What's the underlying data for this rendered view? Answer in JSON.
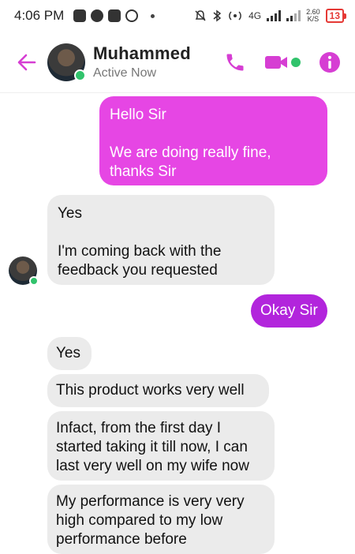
{
  "status_bar": {
    "time": "4:06 PM",
    "network": "4G",
    "speed_value": "2.60",
    "speed_unit": "K/S",
    "battery": "13"
  },
  "header": {
    "contact_name": "Muhammed",
    "contact_status": "Active Now",
    "icons": [
      "back-arrow-icon",
      "phone-icon",
      "video-camera-icon",
      "info-icon"
    ],
    "accent_color": "#d63ed3"
  },
  "messages": [
    {
      "direction": "outgoing",
      "text": "Hello Sir\n\nWe are doing really fine, thanks Sir",
      "color": "#e646e4"
    },
    {
      "direction": "incoming",
      "text": "Yes\n\nI'm coming back with the feedback you requested"
    },
    {
      "direction": "outgoing",
      "text": "Okay Sir",
      "color": "#b225dc"
    },
    {
      "direction": "incoming",
      "text": "Yes"
    },
    {
      "direction": "incoming",
      "text": "This product works very well"
    },
    {
      "direction": "incoming",
      "text": "Infact, from the first day I started taking it till now, I can last very well on my wife now"
    },
    {
      "direction": "incoming",
      "text": "My performance is very very high compared to my low performance before"
    }
  ]
}
